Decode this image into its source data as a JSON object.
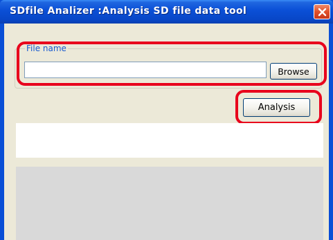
{
  "window": {
    "title": "SDfile Analizer :Analysis SD file data tool"
  },
  "file_group": {
    "legend": "File name",
    "file_input": {
      "value": "",
      "placeholder": ""
    },
    "browse_label": "Browse"
  },
  "actions": {
    "analysis_label": "Analysis"
  },
  "colors": {
    "titlebar": "#0a4fd6",
    "client_background": "#ece9d8",
    "highlight_border": "#e8001c",
    "legend_text": "#1a5bd0",
    "log_area": "#d9d9d9"
  },
  "icons": {
    "close": "close-icon"
  }
}
